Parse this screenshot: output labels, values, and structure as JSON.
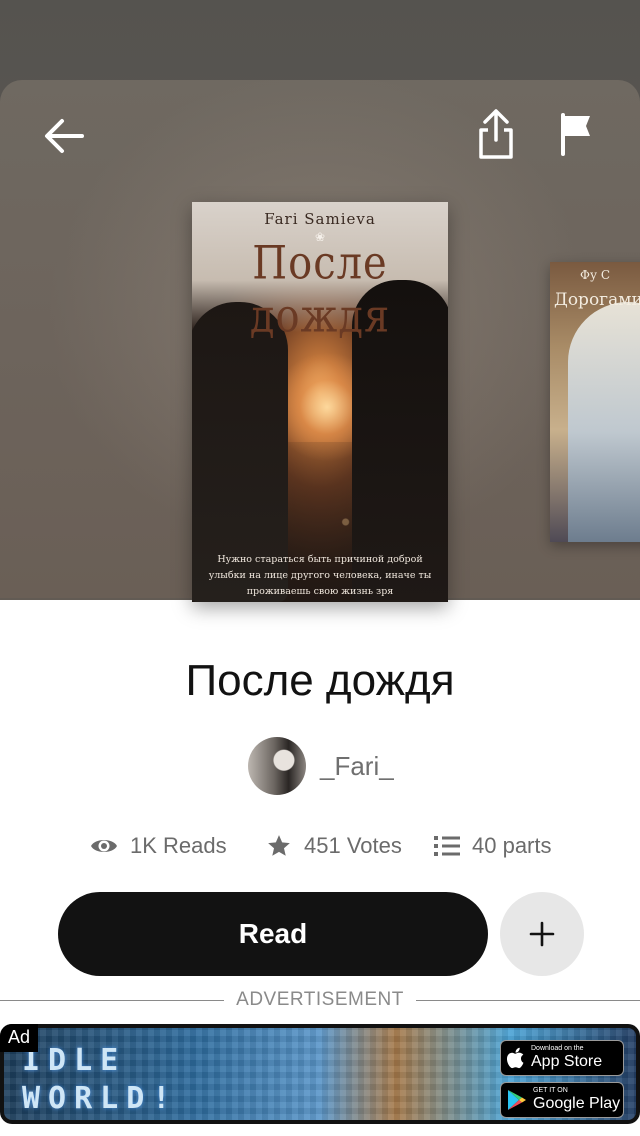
{
  "cover": {
    "author": "Fari Samieva",
    "title": "После дождя",
    "quote": "Нужно стараться быть причиной доброй улыбки на лице другого человека, иначе ты проживаешь свою жизнь зря"
  },
  "next_cover": {
    "author": "Фу С",
    "title": "Дорогами"
  },
  "story": {
    "title": "После дождя",
    "author": "_Fari_"
  },
  "stats": {
    "reads": "1K Reads",
    "votes": "451 Votes",
    "parts": "40 parts"
  },
  "actions": {
    "read_label": "Read",
    "add_label": "+"
  },
  "ad": {
    "divider_label": "ADVERTISEMENT",
    "badge": "Ad",
    "game_title_line1": "IDLE",
    "game_title_line2": "WORLD!",
    "app_store_small": "Download on the",
    "app_store_big": "App Store",
    "google_play_small": "GET IT ON",
    "google_play_big": "Google Play"
  },
  "icons": {
    "back": "arrow-left-icon",
    "share": "share-icon",
    "flag": "flag-icon",
    "reads": "eye-icon",
    "votes": "star-icon",
    "parts": "list-icon",
    "add": "plus-icon"
  },
  "colors": {
    "primary_button": "#121212",
    "secondary_button": "#e7e7e7",
    "muted_text": "#6b6b6b"
  }
}
